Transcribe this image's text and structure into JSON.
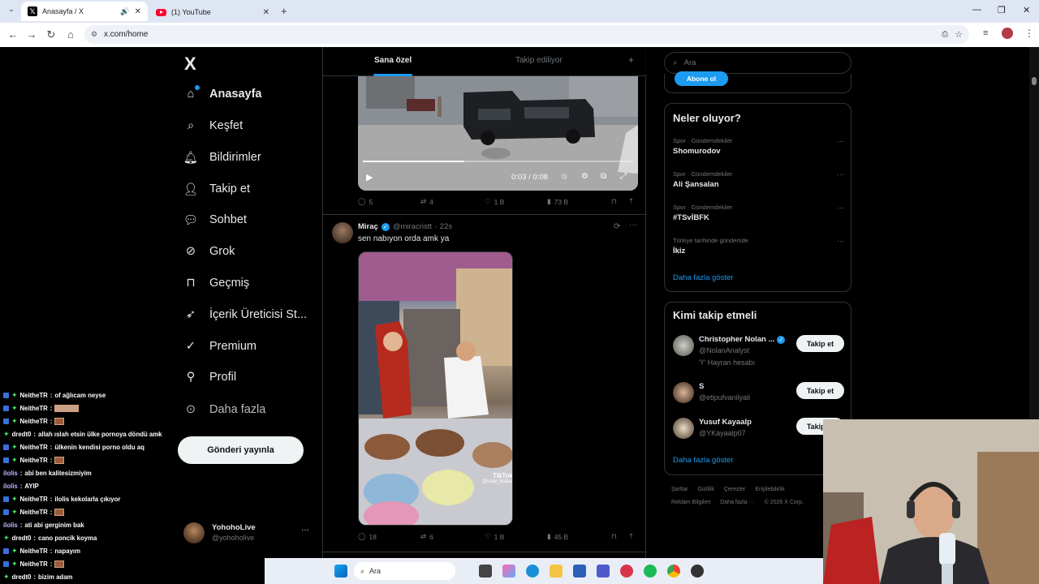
{
  "browser": {
    "tabs": [
      {
        "title": "Anasayfa / X",
        "active": true
      },
      {
        "title": "(1) YouTube",
        "active": false
      }
    ],
    "new_tab": "+",
    "address": "x.com/home",
    "win_controls": [
      "—",
      "❐",
      "✕"
    ]
  },
  "x": {
    "logo": "X",
    "nav": [
      {
        "label": "Anasayfa",
        "icon": "home-icon",
        "active": true
      },
      {
        "label": "Keşfet",
        "icon": "search-icon"
      },
      {
        "label": "Bildirimler",
        "icon": "bell-icon"
      },
      {
        "label": "Takip et",
        "icon": "follow-icon"
      },
      {
        "label": "Sohbet",
        "icon": "chat-icon"
      },
      {
        "label": "Grok",
        "icon": "grok-icon"
      },
      {
        "label": "Geçmiş",
        "icon": "bookmark-icon"
      },
      {
        "label": "İçerik Üreticisi St...",
        "icon": "rocket-icon"
      },
      {
        "label": "Premium",
        "icon": "premium-icon"
      },
      {
        "label": "Profil",
        "icon": "person-icon"
      },
      {
        "label": "Daha fazla",
        "icon": "more-circle-icon"
      }
    ],
    "post_button": "Gönderi yayınla",
    "profile": {
      "name": "YohohoLive",
      "handle": "@yohoholive",
      "more": "···"
    }
  },
  "feed": {
    "tabs": [
      "Sana özel",
      "Takip ediliyor"
    ],
    "add": "+",
    "video": {
      "time": "0:03 / 0:08",
      "progress": 0.375
    },
    "post1_actions": {
      "replies": "5",
      "reposts": "4",
      "likes": "1 B",
      "views": "73 B"
    },
    "post2": {
      "name": "Miraç",
      "handle": "@miracristt",
      "time": "· 22s",
      "text": "sen nabıyon orda amk ya",
      "watermark": "TikTok",
      "watermark_user": "@islap_butea",
      "actions": {
        "replies": "18",
        "reposts": "6",
        "likes": "1 B",
        "views": "45 B"
      }
    }
  },
  "right": {
    "search_placeholder": "Ara",
    "subscribe_btn": "Abone ol",
    "trends_title": "Neler oluyor?",
    "trends": [
      {
        "meta": "Spor · Gündemdekiler",
        "title": "Shomurodov"
      },
      {
        "meta": "Spor · Gündemdekiler",
        "title": "Ali Şansalan"
      },
      {
        "meta": "Spor · Gündemdekiler",
        "title": "#TSvİBFK"
      },
      {
        "meta": "Türkiye tarihinde gündemde",
        "title": "İkiz"
      }
    ],
    "trends_more": "Daha fazla göster",
    "follow_title": "Kimi takip etmeli",
    "follow": [
      {
        "name": "Christopher Nolan ...",
        "handle": "@NolanAnalyst",
        "extra": "Hayran hesabı",
        "btn": "Takip et"
      },
      {
        "name": "S",
        "handle": "@etipufvanilyali",
        "btn": "Takip et"
      },
      {
        "name": "Yusuf Kayaalp",
        "handle": "@YKayaalp07",
        "btn": "Takip et"
      }
    ],
    "follow_more": "Daha fazla göster",
    "footer1": [
      "Şartlar",
      "Gizlilik",
      "Çerezler",
      "Erişilebilirlik"
    ],
    "footer2": [
      "Reklam Bilgileri",
      "Daha fazla ···",
      "© 2026 X Corp."
    ]
  },
  "chat": [
    {
      "user": "NeitheTR",
      "msg": "of ağlıcam neyse",
      "icons": true
    },
    {
      "user": "NeitheTR",
      "msg": "",
      "emote": "wide",
      "icons": true
    },
    {
      "user": "NeitheTR",
      "msg": "",
      "emote": "small",
      "icons": true
    },
    {
      "user": "dredt0",
      "msg": "allah ıslah etsin ülke pornoya döndü amk",
      "icons": false,
      "plus": true
    },
    {
      "user": "NeitheTR",
      "msg": "ülkenin kendisi porno oldu aq",
      "icons": true
    },
    {
      "user": "NeitheTR",
      "msg": "",
      "emote": "small",
      "icons": true
    },
    {
      "user": "ilolis",
      "msg": "abi ben kalitesizmiyim",
      "icons": false,
      "purple": true
    },
    {
      "user": "ilolis",
      "msg": "AYIP",
      "icons": false,
      "purple": true
    },
    {
      "user": "NeitheTR",
      "msg": "ilolis kekolarla çıkıyor",
      "icons": true
    },
    {
      "user": "NeitheTR",
      "msg": "",
      "emote": "small",
      "icons": true
    },
    {
      "user": "ilolis",
      "msg": "ati abi gerginim bak",
      "icons": false,
      "purple": true
    },
    {
      "user": "dredt0",
      "msg": "cano poncik koyma",
      "icons": false,
      "plus": true
    },
    {
      "user": "NeitheTR",
      "msg": "napayım",
      "icons": true
    },
    {
      "user": "NeitheTR",
      "msg": "",
      "emote": "small",
      "icons": true
    },
    {
      "user": "dredt0",
      "msg": "bizim adam",
      "icons": false,
      "plus": true
    }
  ],
  "taskbar": {
    "search": "Ara"
  },
  "colors": {
    "accent": "#1d9bf0",
    "border": "#2f3336",
    "muted": "#71767b"
  }
}
